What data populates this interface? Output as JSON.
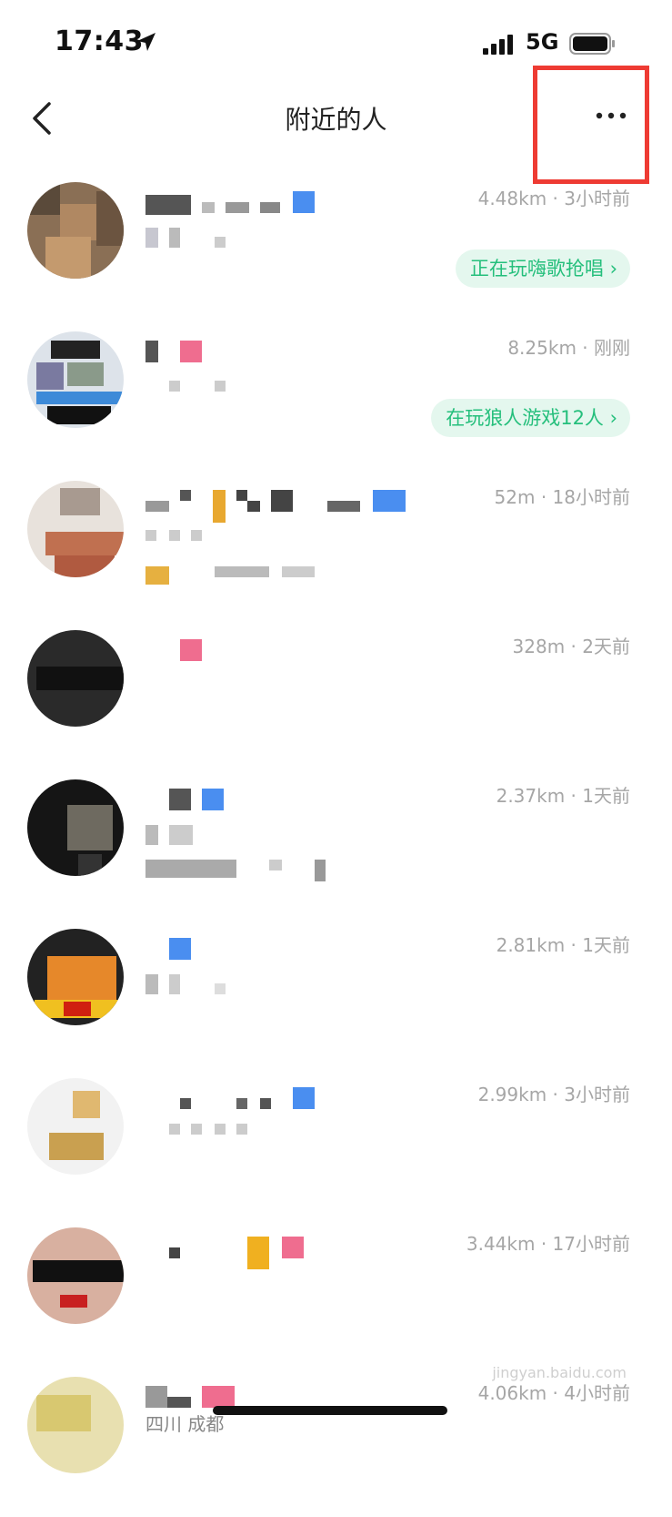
{
  "status_bar": {
    "time": "17:43",
    "network": "5G"
  },
  "nav": {
    "title": "附近的人"
  },
  "people": [
    {
      "meta": "4.48km · 3小时前",
      "activity": "正在玩嗨歌抢唱 ›"
    },
    {
      "meta": "8.25km · 刚刚",
      "activity": "在玩狼人游戏12人 ›"
    },
    {
      "meta": "52m · 18小时前"
    },
    {
      "meta": "328m · 2天前"
    },
    {
      "meta": "2.37km · 1天前"
    },
    {
      "meta": "2.81km · 1天前"
    },
    {
      "meta": "2.99km · 3小时前"
    },
    {
      "meta": "3.44km · 17小时前"
    },
    {
      "meta": "4.06km · 4小时前",
      "region": "四川 成都"
    }
  ],
  "watermark": "jingyan.baidu.com",
  "colors": {
    "accent_green": "#25bf7c",
    "highlight_red": "#ee3b33",
    "meta_gray": "#a6a6a6"
  }
}
